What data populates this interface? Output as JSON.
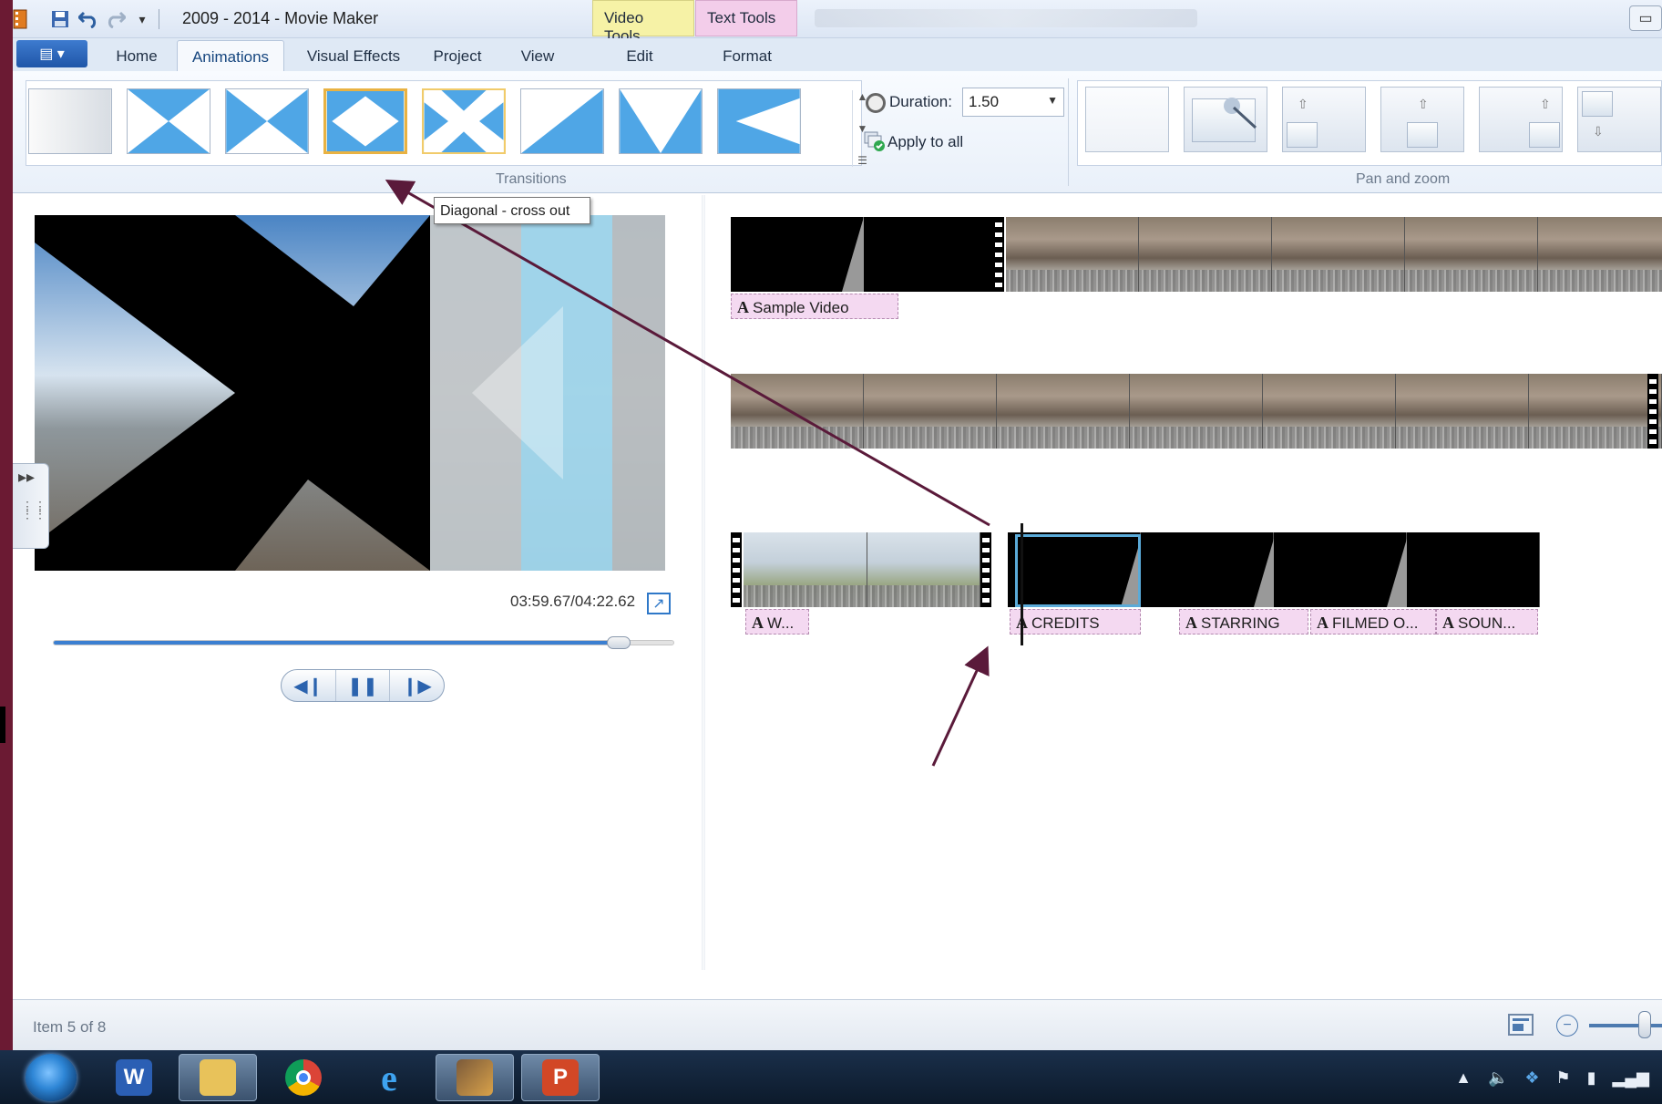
{
  "window": {
    "title": "2009 - 2014 - Movie Maker",
    "context_tabs": [
      "Video Tools",
      "Text Tools"
    ]
  },
  "quick_access": {
    "icons": [
      "movie-maker-icon",
      "save-icon",
      "undo-icon",
      "redo-icon",
      "customize-qat-icon"
    ]
  },
  "ribbon": {
    "tabs": [
      {
        "label": "Home",
        "active": false
      },
      {
        "label": "Animations",
        "active": true
      },
      {
        "label": "Visual Effects",
        "active": false
      },
      {
        "label": "Project",
        "active": false
      },
      {
        "label": "View",
        "active": false
      },
      {
        "label": "Edit",
        "active": false
      },
      {
        "label": "Format",
        "active": false
      }
    ],
    "transitions": {
      "group_label": "Transitions",
      "selected_index": 3,
      "hovered_index": 4
    },
    "duration": {
      "label": "Duration:",
      "value": "1.50"
    },
    "apply_all_label": "Apply to all",
    "pan_zoom": {
      "group_label": "Pan and zoom"
    }
  },
  "tooltip": {
    "text": "Diagonal - cross out"
  },
  "preview": {
    "time": "03:59.67/04:22.62",
    "progress": 0.912
  },
  "storyboard": {
    "captions": {
      "sample": "Sample Video",
      "w": "W...",
      "credits": "CREDITS",
      "starring": "STARRING",
      "filmed": "FILMED O...",
      "sound": "SOUN..."
    }
  },
  "status": {
    "text": "Item 5 of 8",
    "zoom_level": 0.7
  },
  "colors": {
    "accent": "#3b7fd1",
    "selected_thumb": "#e9b242",
    "caption_bg": "#f4d9f1",
    "video_tools": "#f6f2a6",
    "text_tools": "#f3cdea",
    "annotation_arrow": "#5a1a3a"
  }
}
